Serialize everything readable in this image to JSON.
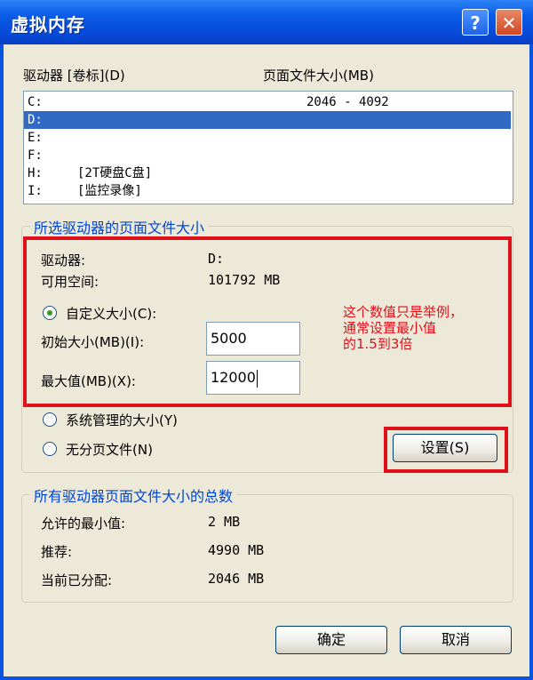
{
  "window": {
    "title": "虚拟内存"
  },
  "titlebar": {
    "help": "?",
    "close": "✕"
  },
  "drive_list": {
    "header_drive": "驱动器 [卷标](D)",
    "header_size": "页面文件大小(MB)",
    "rows": [
      {
        "drive": "C:",
        "label": "",
        "size": "2046 - 4092",
        "selected": false
      },
      {
        "drive": "D:",
        "label": "",
        "size": "",
        "selected": true
      },
      {
        "drive": "E:",
        "label": "",
        "size": "",
        "selected": false
      },
      {
        "drive": "F:",
        "label": "",
        "size": "",
        "selected": false
      },
      {
        "drive": "H:",
        "label": "[2T硬盘C盘]",
        "size": "",
        "selected": false
      },
      {
        "drive": "I:",
        "label": "[监控录像]",
        "size": "",
        "selected": false
      }
    ]
  },
  "selected_drive": {
    "group_title": "所选驱动器的页面文件大小",
    "drive_label": "驱动器:",
    "drive_value": "D:",
    "space_label": "可用空间:",
    "space_value": "101792 MB",
    "custom_size": "自定义大小(C):",
    "initial_label": "初始大小(MB)(I):",
    "initial_value": "5000",
    "max_label": "最大值(MB)(X):",
    "max_value": "12000",
    "system_managed": "系统管理的大小(Y)",
    "no_paging": "无分页文件(N)",
    "set_button": "设置(S)",
    "annotation": [
      "这个数值只是举例，",
      "通常设置最小值",
      "的1.5到3倍"
    ]
  },
  "totals": {
    "group_title": "所有驱动器页面文件大小的总数",
    "min_label": "允许的最小值:",
    "min_value": "2 MB",
    "rec_label": "推荐:",
    "rec_value": "4990 MB",
    "cur_label": "当前已分配:",
    "cur_value": "2046 MB"
  },
  "buttons": {
    "ok": "确定",
    "cancel": "取消"
  },
  "colors": {
    "accent_red": "#e0101a",
    "group_title": "#0046d5",
    "selection": "#316ac5"
  }
}
